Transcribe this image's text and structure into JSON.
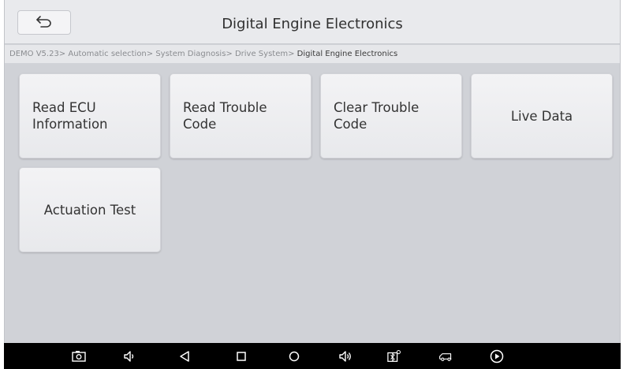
{
  "header": {
    "title": "Digital Engine Electronics",
    "back_icon": "back-arrow-icon"
  },
  "breadcrumb": {
    "path": "DEMO V5.23> Automatic selection> System Diagnosis> Drive System>",
    "current": " Digital Engine Electronics"
  },
  "menu": {
    "items": [
      {
        "line1": "Read ECU",
        "line2": "Information"
      },
      {
        "line1": "Read Trouble",
        "line2": "Code"
      },
      {
        "line1": "Clear Trouble",
        "line2": "Code"
      },
      {
        "label": "Live Data"
      },
      {
        "label": "Actuation Test"
      }
    ]
  },
  "system_bar": {
    "icons": [
      "screenshot-icon",
      "volume-down-icon",
      "back-icon",
      "recents-icon",
      "home-icon",
      "volume-up-icon",
      "vci-connection-icon",
      "vehicle-icon",
      "play-icon"
    ]
  },
  "colors": {
    "background": "#d0d2d7",
    "tile": "#efeff2",
    "titlebar": "#e9eaed",
    "navbar": "#000000"
  }
}
